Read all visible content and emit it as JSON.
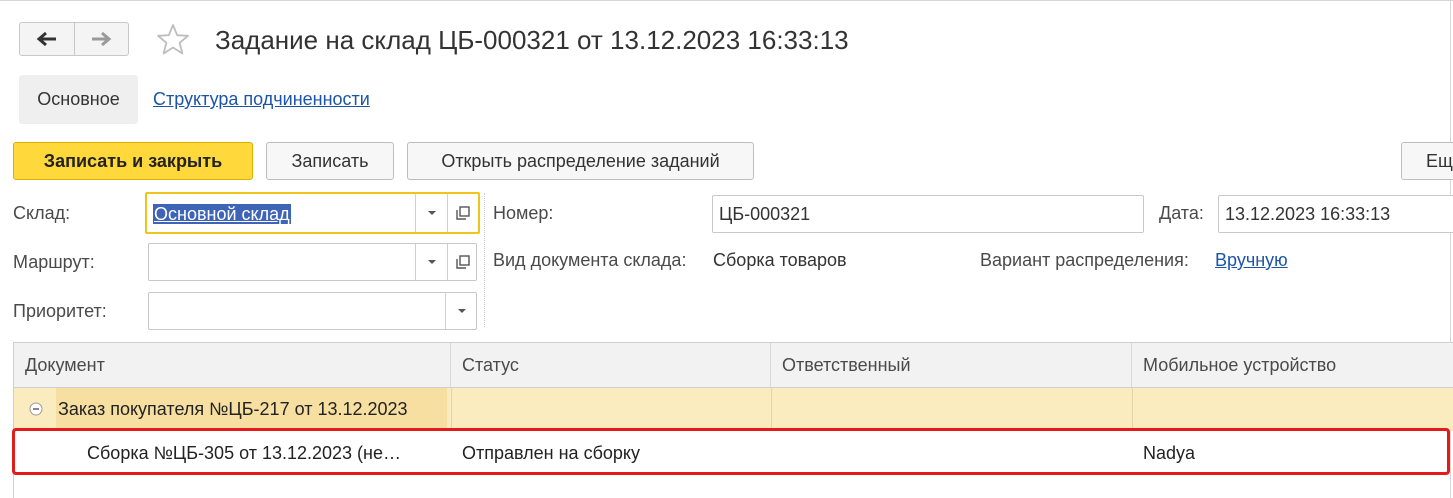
{
  "window": {
    "title": "Задание на склад ЦБ-000321 от 13.12.2023 16:33:13"
  },
  "nav": {
    "back_icon": "arrow-left-icon",
    "forward_icon": "arrow-right-icon",
    "favorite_icon": "star-outline-icon"
  },
  "tabs": [
    {
      "label": "Основное",
      "active": true
    },
    {
      "label": "Структура подчиненности",
      "active": false
    }
  ],
  "toolbar": {
    "save_close_label": "Записать и закрыть",
    "save_label": "Записать",
    "open_distribution_label": "Открыть распределение заданий",
    "more_label": "Ещ"
  },
  "form": {
    "warehouse_label": "Склад:",
    "warehouse_value": "Основной склад",
    "route_label": "Маршрут:",
    "route_value": "",
    "priority_label": "Приоритет:",
    "priority_value": "",
    "number_label": "Номер:",
    "number_value": "ЦБ-000321",
    "date_label": "Дата:",
    "date_value": "13.12.2023 16:33:13",
    "doc_type_label": "Вид документа склада:",
    "doc_type_value": "Сборка товаров",
    "distribution_label": "Вариант распределения:",
    "distribution_value": "Вручную"
  },
  "table": {
    "columns": [
      "Документ",
      "Статус",
      "Ответственный",
      "Мобильное устройство"
    ],
    "groups": [
      {
        "label": "Заказ покупателя №ЦБ-217 от 13.12.2023",
        "rows": [
          {
            "document": "Сборка №ЦБ-305 от 13.12.2023 (не…",
            "status": "Отправлен на сборку",
            "responsible": "",
            "device": "Nadya"
          }
        ]
      }
    ]
  },
  "colors": {
    "accent_yellow": "#ffd83b",
    "link_blue": "#1c55a8",
    "selection_blue": "#3e64b8",
    "group_row_bg": "#fbecc0",
    "highlight_red": "#e51a1a"
  }
}
